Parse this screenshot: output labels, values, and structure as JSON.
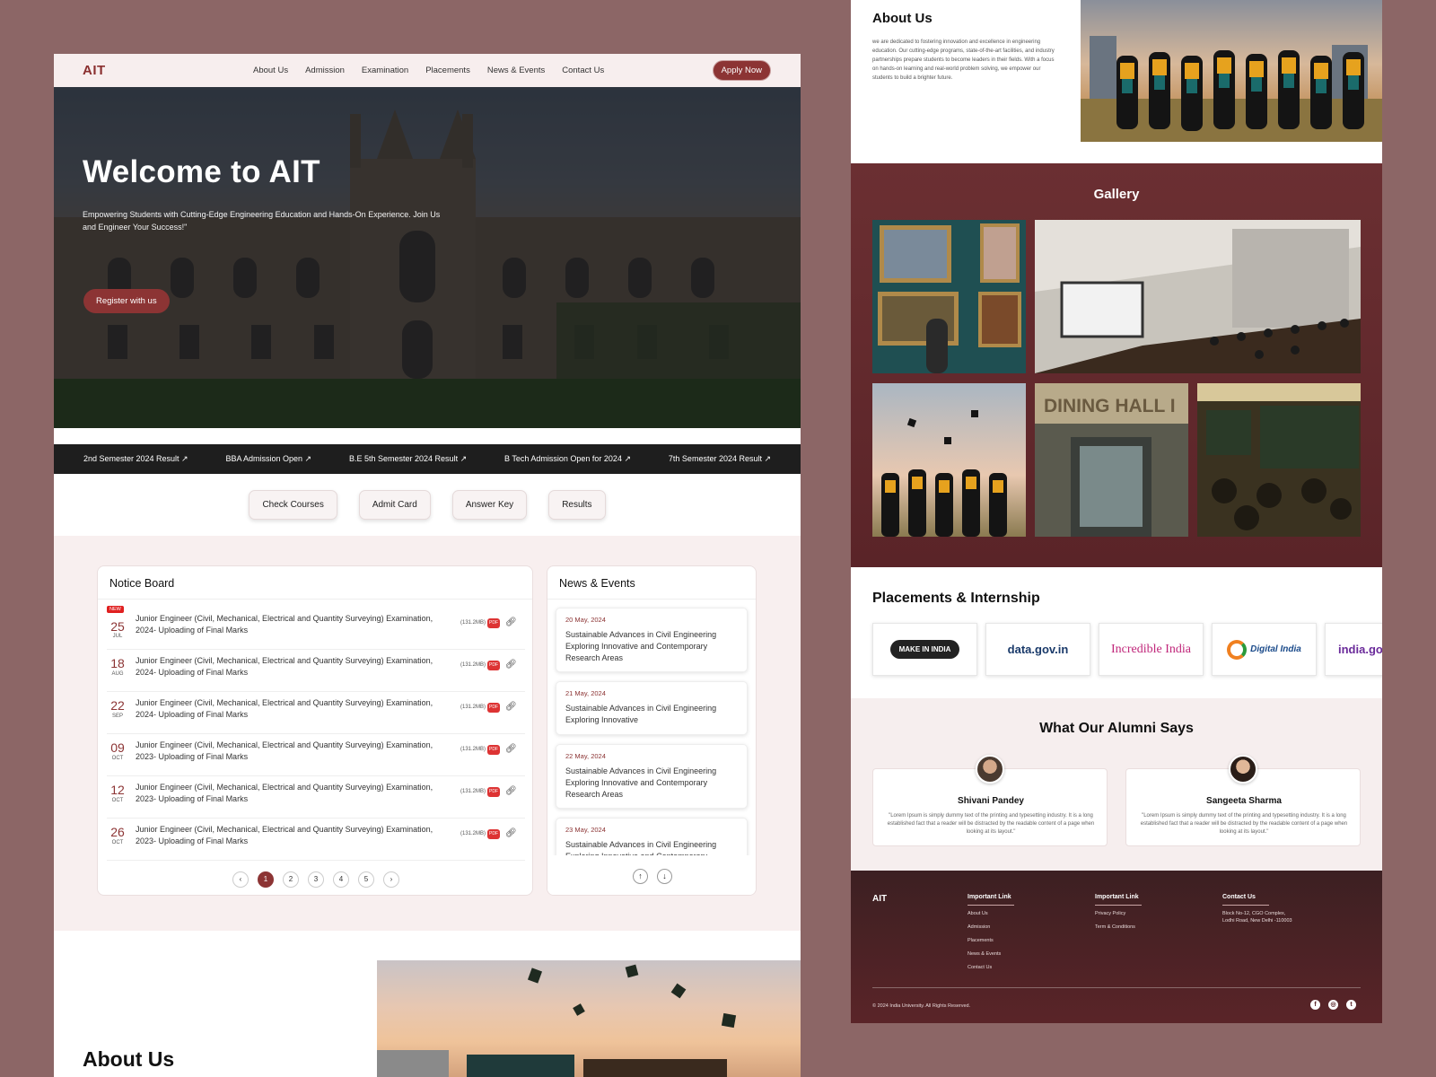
{
  "left": {
    "logo": "AIT",
    "nav": [
      "About Us",
      "Admission",
      "Examination",
      "Placements",
      "News & Events",
      "Contact Us"
    ],
    "apply_label": "Apply Now",
    "hero": {
      "title": "Welcome to AIT",
      "subtitle": "Empowering Students with Cutting-Edge Engineering Education and Hands-On Experience. Join Us and Engineer Your Success!\"",
      "cta": "Register with us"
    },
    "ticker": [
      "2nd Semester 2024 Result ↗",
      "BBA Admission Open ↗",
      "B.E 5th Semester 2024 Result ↗",
      "B Tech Admission Open for 2024 ↗",
      "7th Semester 2024 Result ↗"
    ],
    "quick_links": [
      "Check Courses",
      "Admit Card",
      "Answer Key",
      "Results"
    ],
    "notice_board": {
      "title": "Notice Board",
      "new_badge": "NEW",
      "rows": [
        {
          "day": "25",
          "month": "JUL",
          "text": "Junior Engineer (Civil, Mechanical, Electrical and Quantity Surveying) Examination, 2024- Uploading of Final Marks",
          "size": "(131.2MB)",
          "pdf": "PDF"
        },
        {
          "day": "18",
          "month": "AUG",
          "text": "Junior Engineer (Civil, Mechanical, Electrical and Quantity Surveying) Examination, 2024- Uploading of Final Marks",
          "size": "(131.2MB)",
          "pdf": "PDF"
        },
        {
          "day": "22",
          "month": "SEP",
          "text": "Junior Engineer (Civil, Mechanical, Electrical and Quantity Surveying) Examination, 2024- Uploading of Final Marks",
          "size": "(131.2MB)",
          "pdf": "PDF"
        },
        {
          "day": "09",
          "month": "OCT",
          "text": "Junior Engineer (Civil, Mechanical, Electrical and Quantity Surveying) Examination, 2023- Uploading of Final Marks",
          "size": "(131.2MB)",
          "pdf": "PDF"
        },
        {
          "day": "12",
          "month": "OCT",
          "text": "Junior Engineer (Civil, Mechanical, Electrical and Quantity Surveying) Examination, 2023- Uploading of Final Marks",
          "size": "(131.2MB)",
          "pdf": "PDF"
        },
        {
          "day": "26",
          "month": "OCT",
          "text": "Junior Engineer (Civil, Mechanical, Electrical and Quantity Surveying) Examination, 2023- Uploading of Final Marks",
          "size": "(131.2MB)",
          "pdf": "PDF"
        }
      ],
      "pages": [
        "1",
        "2",
        "3",
        "4",
        "5"
      ],
      "current_page": "1"
    },
    "news_events": {
      "title": "News & Events",
      "items": [
        {
          "date": "20 May, 2024",
          "text": "Sustainable Advances in Civil Engineering Exploring Innovative and Contemporary Research Areas"
        },
        {
          "date": "21 May, 2024",
          "text": "Sustainable Advances in Civil Engineering Exploring Innovative"
        },
        {
          "date": "22 May, 2024",
          "text": "Sustainable Advances in Civil Engineering Exploring Innovative and Contemporary Research Areas"
        },
        {
          "date": "23 May, 2024",
          "text": "Sustainable Advances in Civil Engineering Exploring Innovative and Contemporary Research Areas"
        }
      ]
    },
    "about_title": "About Us"
  },
  "right": {
    "about": {
      "title": "About Us",
      "body": "we are dedicated to fostering innovation and excellence in engineering education. Our cutting-edge programs, state-of-the-art facilities, and industry partnerships prepare students to become leaders in their fields. With a focus on hands-on learning and real-world problem solving, we empower our students to build a brighter future."
    },
    "gallery_title": "Gallery",
    "gallery_sign": "DINING HALL I",
    "placements": {
      "title": "Placements & Internship",
      "logos": [
        "MAKE IN INDIA",
        "data.gov.in",
        "Incredible India",
        "Digital India",
        "india.gov"
      ]
    },
    "alumni": {
      "title": "What Our Alumni Says",
      "items": [
        {
          "name": "Shivani Pandey",
          "quote": "\"Lorem Ipsum is simply dummy text of the printing and typesetting industry. It is a long established fact that a reader will be distracted by the readable content of a page when looking at its layout.\""
        },
        {
          "name": "Sangeeta Sharma",
          "quote": "\"Lorem Ipsum is simply dummy text of the printing and typesetting industry. It is a long established fact that a reader will be distracted by the readable content of a page when looking at its layout.\""
        }
      ]
    },
    "footer": {
      "logo": "AIT",
      "col1_title": "Important Link",
      "col1": [
        "About Us",
        "Admission",
        "Placements",
        "News & Events",
        "Contact Us"
      ],
      "col2_title": "Important Link",
      "col2": [
        "Privacy Policy",
        "Term & Conditions"
      ],
      "contact_title": "Contact Us",
      "contact_line1": "Block No-12, CGO Complex,",
      "contact_line2": "Lodhi Road, New Delhi -110003",
      "copyright": "© 2024 India University. All Rights Reserved.",
      "social": [
        "f",
        "◎",
        "t"
      ]
    }
  },
  "colors": {
    "brand": "#8c3434",
    "gallery_bg": "#6b2f32",
    "backdrop": "#8c6666"
  }
}
